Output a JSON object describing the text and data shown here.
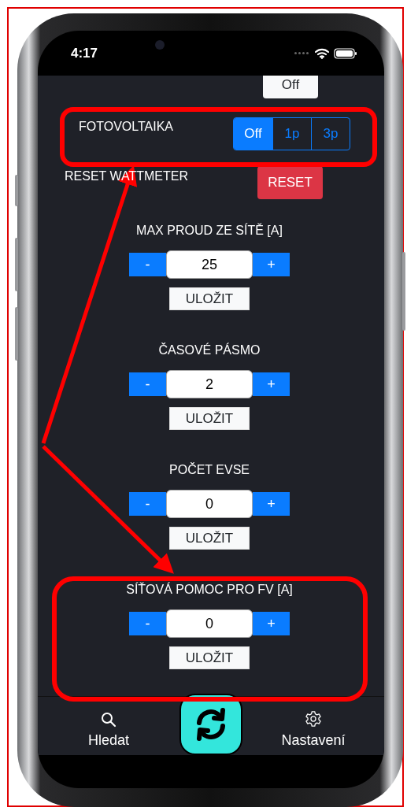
{
  "status_bar": {
    "time": "4:17"
  },
  "top_cut_toggle": {
    "label": "Off"
  },
  "fotovoltaika": {
    "label": "FOTOVOLTAIKA",
    "options": [
      {
        "label": "Off",
        "selected": true
      },
      {
        "label": "1p",
        "selected": false
      },
      {
        "label": "3p",
        "selected": false
      }
    ]
  },
  "reset": {
    "label": "RESET WATTMETER",
    "button": "RESET"
  },
  "steppers": [
    {
      "title": "MAX PROUD ZE SÍTĚ [A]",
      "minus": "-",
      "value": "25",
      "plus": "+",
      "save": "ULOŽIT"
    },
    {
      "title": "ČASOVÉ PÁSMO",
      "minus": "-",
      "value": "2",
      "plus": "+",
      "save": "ULOŽIT"
    },
    {
      "title": "POČET EVSE",
      "minus": "-",
      "value": "0",
      "plus": "+",
      "save": "ULOŽIT"
    },
    {
      "title": "SÍŤOVÁ POMOC PRO FV [A]",
      "minus": "-",
      "value": "0",
      "plus": "+",
      "save": "ULOŽIT"
    }
  ],
  "tab_bar": {
    "items": [
      {
        "kind": "search",
        "label": "Hledat"
      },
      {
        "kind": "refresh"
      },
      {
        "kind": "settings",
        "label": "Nastavení"
      }
    ]
  }
}
